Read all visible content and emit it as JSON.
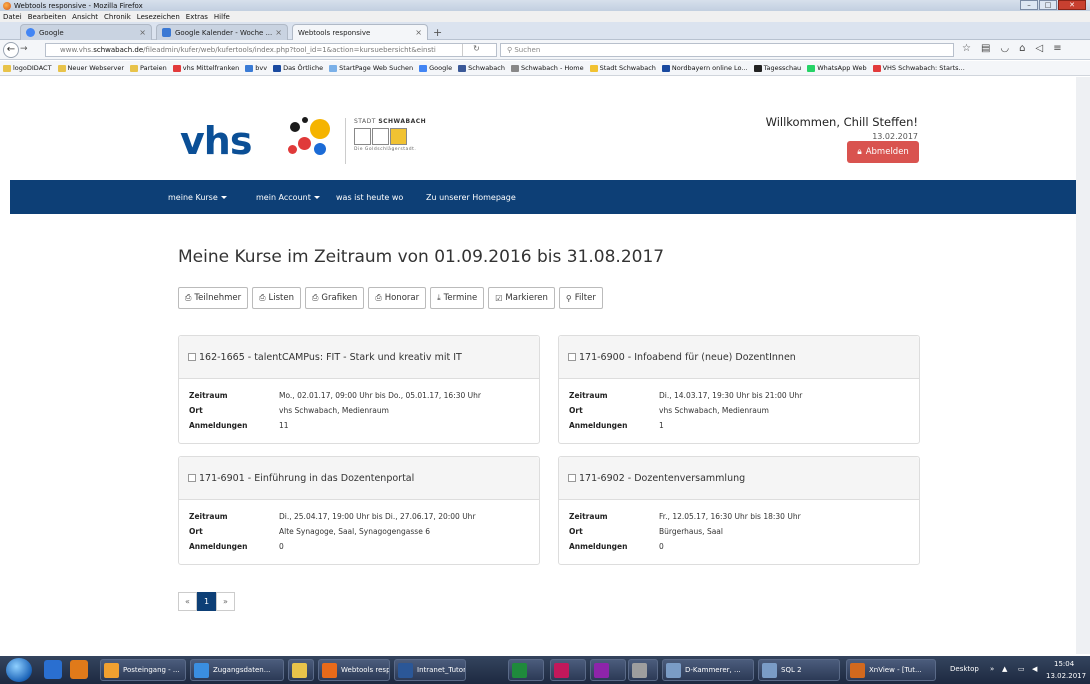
{
  "window": {
    "title": "Webtools responsive - Mozilla Firefox"
  },
  "menu": [
    "Datei",
    "Bearbeiten",
    "Ansicht",
    "Chronik",
    "Lesezeichen",
    "Extras",
    "Hilfe"
  ],
  "tabs": [
    {
      "label": "Google"
    },
    {
      "label": "Google Kalender - Woche ..."
    },
    {
      "label": "Webtools responsive"
    }
  ],
  "urlbar": {
    "prefix": "www.vhs.",
    "domain": "schwabach.de",
    "path": "/fileadmin/kufer/web/kufertools/index.php?tool_id=1&action=kursuebersicht&einsti"
  },
  "search": {
    "placeholder": "Suchen"
  },
  "bookmarks": [
    {
      "label": "logoDIDACT",
      "color": "#e8c34a"
    },
    {
      "label": "Neuer Webserver",
      "color": "#e8c34a"
    },
    {
      "label": "Parteien",
      "color": "#e8c34a"
    },
    {
      "label": "vhs Mittelfranken",
      "color": "#e23b3b"
    },
    {
      "label": "bvv",
      "color": "#3a7bd5"
    },
    {
      "label": "Das Örtliche",
      "color": "#1a4aa0"
    },
    {
      "label": "StartPage Web Suchen",
      "color": "#7ab0e8"
    },
    {
      "label": "Google",
      "color": "#4285f4"
    },
    {
      "label": "Schwabach",
      "color": "#3b5998"
    },
    {
      "label": "Schwabach - Home",
      "color": "#888888"
    },
    {
      "label": "Stadt Schwabach",
      "color": "#f1c232"
    },
    {
      "label": "Nordbayern online Lo...",
      "color": "#1a4aa0"
    },
    {
      "label": "Tagesschau",
      "color": "#222222"
    },
    {
      "label": "WhatsApp Web",
      "color": "#25d366"
    },
    {
      "label": "VHS Schwabach: Starts...",
      "color": "#e23b3b"
    }
  ],
  "header": {
    "logo_text": "vhs",
    "stadt_label_pre": "STADT ",
    "stadt_label_bold": "SCHWABACH",
    "stadt_slogan": "Die Goldschlägerstadt.",
    "welcome": "Willkommen, Chill Steffen!",
    "date": "13.02.2017",
    "logout_label": "Abmelden"
  },
  "nav": [
    {
      "label": "meine Kurse",
      "dropdown": true
    },
    {
      "label": "mein Account",
      "dropdown": true
    },
    {
      "label": "was ist heute wo",
      "dropdown": false
    },
    {
      "label": "Zu unserer Homepage",
      "dropdown": false
    }
  ],
  "page_title": "Meine Kurse im Zeitraum von 01.09.2016 bis 31.08.2017",
  "toolbar": [
    {
      "label": "Teilnehmer",
      "icon": "print-icon"
    },
    {
      "label": "Listen",
      "icon": "print-icon"
    },
    {
      "label": "Grafiken",
      "icon": "print-icon"
    },
    {
      "label": "Honorar",
      "icon": "print-icon"
    },
    {
      "label": "Termine",
      "icon": "download-icon"
    },
    {
      "label": "Markieren",
      "icon": "checkbox-icon"
    },
    {
      "label": "Filter",
      "icon": "search-icon"
    }
  ],
  "course_labels": {
    "zeitraum": "Zeitraum",
    "ort": "Ort",
    "anmeldungen": "Anmeldungen"
  },
  "courses": [
    {
      "title": "162-1665 - talentCAMPus: FIT - Stark und kreativ mit IT",
      "zeitraum": "Mo., 02.01.17, 09:00 Uhr bis Do., 05.01.17, 16:30 Uhr",
      "ort": "vhs Schwabach, Medienraum",
      "anmeldungen": "11"
    },
    {
      "title": "171-6900 - Infoabend für (neue) DozentInnen",
      "zeitraum": "Di., 14.03.17, 19:30 Uhr bis 21:00 Uhr",
      "ort": "vhs Schwabach, Medienraum",
      "anmeldungen": "1"
    },
    {
      "title": "171-6901 - Einführung in das Dozentenportal",
      "zeitraum": "Di., 25.04.17, 19:00 Uhr bis Di., 27.06.17, 20:00 Uhr",
      "ort": "Alte Synagoge, Saal, Synagogengasse 6",
      "anmeldungen": "0"
    },
    {
      "title": "171-6902 - Dozentenversammlung",
      "zeitraum": "Fr., 12.05.17, 16:30 Uhr bis 18:30 Uhr",
      "ort": "Bürgerhaus, Saal",
      "anmeldungen": "0"
    }
  ],
  "pager": {
    "prev": "«",
    "current": "1",
    "next": "»"
  },
  "taskbar": {
    "items": [
      {
        "label": "Posteingang - ...",
        "color": "#f0a030"
      },
      {
        "label": "Zugangsdaten...",
        "color": "#3a8ee0"
      },
      {
        "label": "",
        "color": "#e8c34a"
      },
      {
        "label": "Webtools resp...",
        "color": "#e86a1a"
      },
      {
        "label": "Intranet_Tutori...",
        "color": "#2b5797"
      },
      {
        "label": "",
        "color": "#1f8a3c"
      },
      {
        "label": "",
        "color": "#c2185b"
      },
      {
        "label": "",
        "color": "#8e24aa"
      },
      {
        "label": "",
        "color": "#9e9e9e"
      },
      {
        "label": "D-Kammerer, ...",
        "color": "#7a9cc6"
      },
      {
        "label": "SQL 2",
        "color": "#7a9cc6"
      },
      {
        "label": "XnView - [Tut...",
        "color": "#d2691e"
      }
    ],
    "desktop_label": "Desktop",
    "time": "15:04",
    "date": "13.02.2017"
  }
}
